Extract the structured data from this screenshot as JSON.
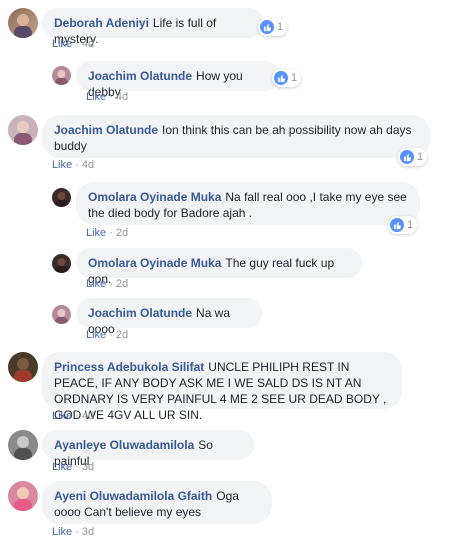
{
  "comments": [
    {
      "author": "Deborah Adeniyi",
      "text": "Life is full of mystery.",
      "time": "4d",
      "likes": "1",
      "like_label": "Like"
    },
    {
      "author": "Joachim Olatunde",
      "text": "How you debby",
      "time": "4d",
      "likes": "1",
      "like_label": "Like"
    },
    {
      "author": "Joachim Olatunde",
      "text": "Ion think this can be ah possibility now ah days buddy",
      "time": "4d",
      "likes": "1",
      "like_label": "Like"
    },
    {
      "author": "Omolara Oyinade Muka",
      "text": "Na fall real ooo ,I take my eye see the died body for Badore ajah .",
      "time": "2d",
      "likes": "1",
      "like_label": "Like"
    },
    {
      "author": "Omolara Oyinade Muka",
      "text": "The guy real fuck up gon.",
      "time": "2d",
      "like_label": "Like"
    },
    {
      "author": "Joachim Olatunde",
      "text": "Na wa oooo",
      "time": "2d",
      "like_label": "Like"
    },
    {
      "author": "Princess Adebukola Silifat",
      "text": "UNCLE PHILIPH REST IN PEACE, IF ANY BODY ASK ME I WE SALD DS IS NT AN ORDNARY IS VERY PAINFUL 4 ME 2 SEE UR DEAD BODY , GOD WE 4GV ALL UR SIN.",
      "time": "4d",
      "like_label": "Like"
    },
    {
      "author": "Ayanleye Oluwadamilola",
      "text": "So painful",
      "time": "3d",
      "like_label": "Like"
    },
    {
      "author": "Ayeni Oluwadamilola Gfaith",
      "text": "Oga oooo Can't believe my eyes",
      "time": "3d",
      "like_label": "Like"
    }
  ],
  "separator": "·",
  "colors": {
    "link": "#385898",
    "like": "#4267b2",
    "bubble": "#f2f3f5",
    "meta": "#90949c",
    "reaction": "#5890ff"
  },
  "icons": {
    "reaction": "thumbs-up-icon"
  }
}
